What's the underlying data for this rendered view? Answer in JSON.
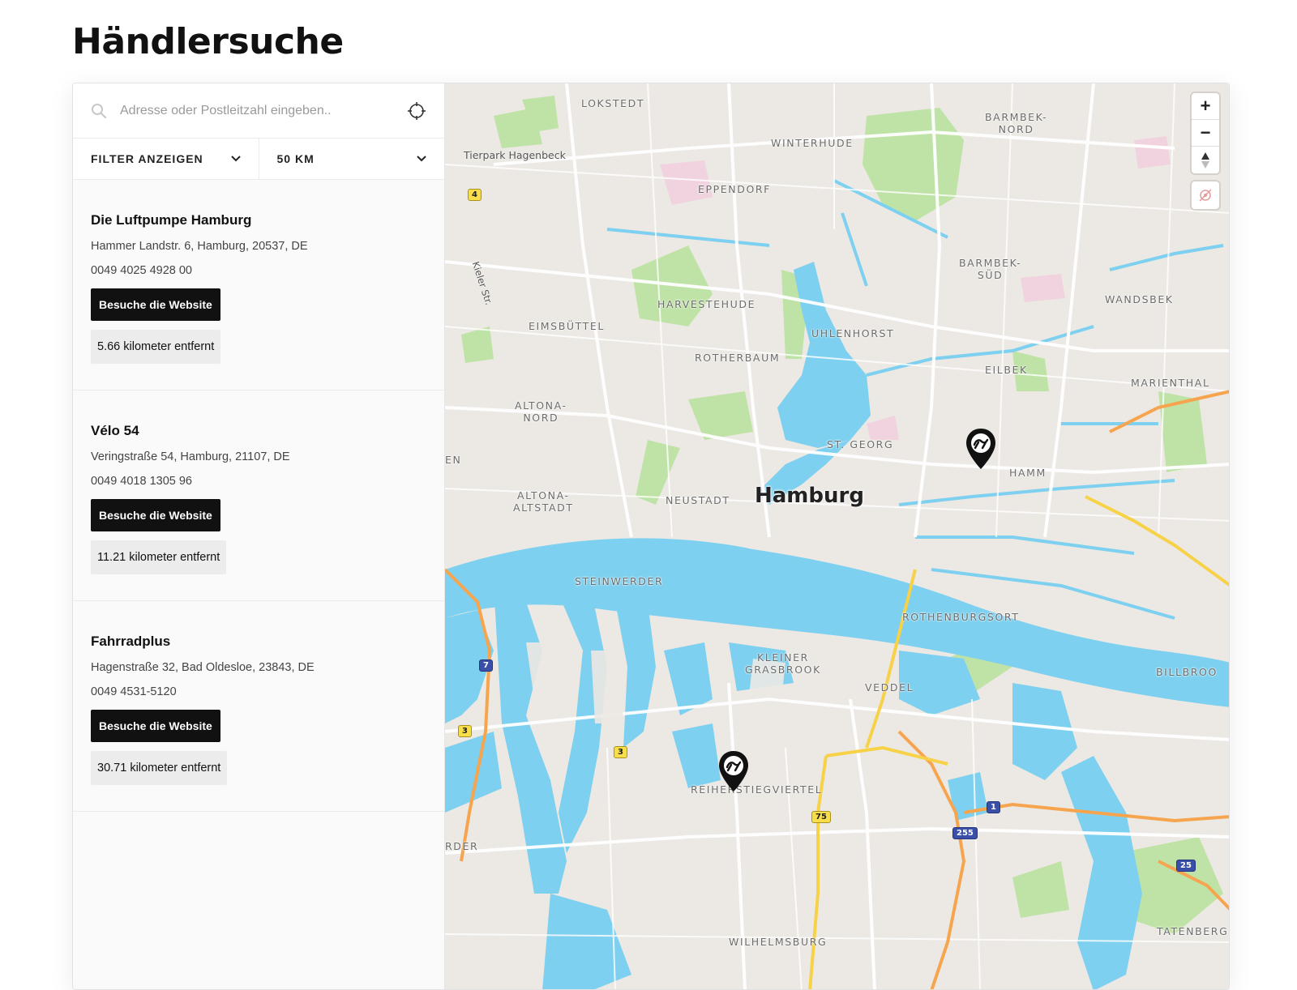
{
  "page": {
    "title": "Händlersuche"
  },
  "search": {
    "placeholder": "Adresse oder Postleitzahl eingeben.."
  },
  "filters": {
    "filter_label": "FILTER ANZEIGEN",
    "radius_label": "50 KM"
  },
  "results": [
    {
      "name": "Die Luftpumpe Hamburg",
      "address": "Hammer Landstr. 6, Hamburg, 20537, DE",
      "phone": "0049 4025 4928 00",
      "website_label": "Besuche die Website",
      "distance": "5.66 kilometer entfernt"
    },
    {
      "name": "Vélo 54",
      "address": "Veringstraße 54, Hamburg, 21107, DE",
      "phone": "0049 4018 1305 96",
      "website_label": "Besuche die Website",
      "distance": "11.21 kilometer entfernt"
    },
    {
      "name": "Fahrradplus",
      "address": "Hagenstraße 32, Bad Oldesloe, 23843, DE",
      "phone": "0049 4531-5120",
      "website_label": "Besuche die Website",
      "distance": "30.71 kilometer entfernt"
    }
  ],
  "map": {
    "city": "Hamburg",
    "poi": "Tierpark Hagenbeck",
    "street": "Kieler Str.",
    "districts": {
      "lokstedt": "LOKSTEDT",
      "winterhude": "WINTERHUDE",
      "barmbek_nord": "BARMBEK-\nNORD",
      "eppendorf": "EPPENDORF",
      "barmbek_sued": "BARMBEK-\nSÜD",
      "wandsbek": "WANDSBEK",
      "harvestehude": "HARVESTEHUDE",
      "eimsbuettel": "EIMSBÜTTEL",
      "uhlenhorst": "UHLENHORST",
      "rotherbaum": "ROTHERBAUM",
      "eilbek": "EILBEK",
      "marienthal": "MARIENTHAL",
      "altona_nord": "ALTONA-\nNORD",
      "st_georg": "ST. GEORG",
      "hamm": "HAMM",
      "en": "EN",
      "altona_altstadt": "ALTONA-\nALTSTADT",
      "neustadt": "NEUSTADT",
      "steinwerder": "STEINWERDER",
      "rothenburgsort": "ROTHENBURGSORT",
      "kleiner_grasbrook": "KLEINER\nGRASBROOK",
      "billbrook": "BILLBROO",
      "veddel": "VEDDEL",
      "reiherstieg": "REIHERSTIEGVIERTEL",
      "rder": "RDER",
      "tatenberg": "TATENBERG",
      "wilhelmsburg": "WILHELMSBURG"
    },
    "shields": {
      "s4": "4",
      "s7": "7",
      "s3a": "3",
      "s3b": "3",
      "s75": "75",
      "s1": "1",
      "s255": "255",
      "s25": "25"
    },
    "controls": {
      "zoom_in": "+",
      "zoom_out": "−"
    }
  }
}
